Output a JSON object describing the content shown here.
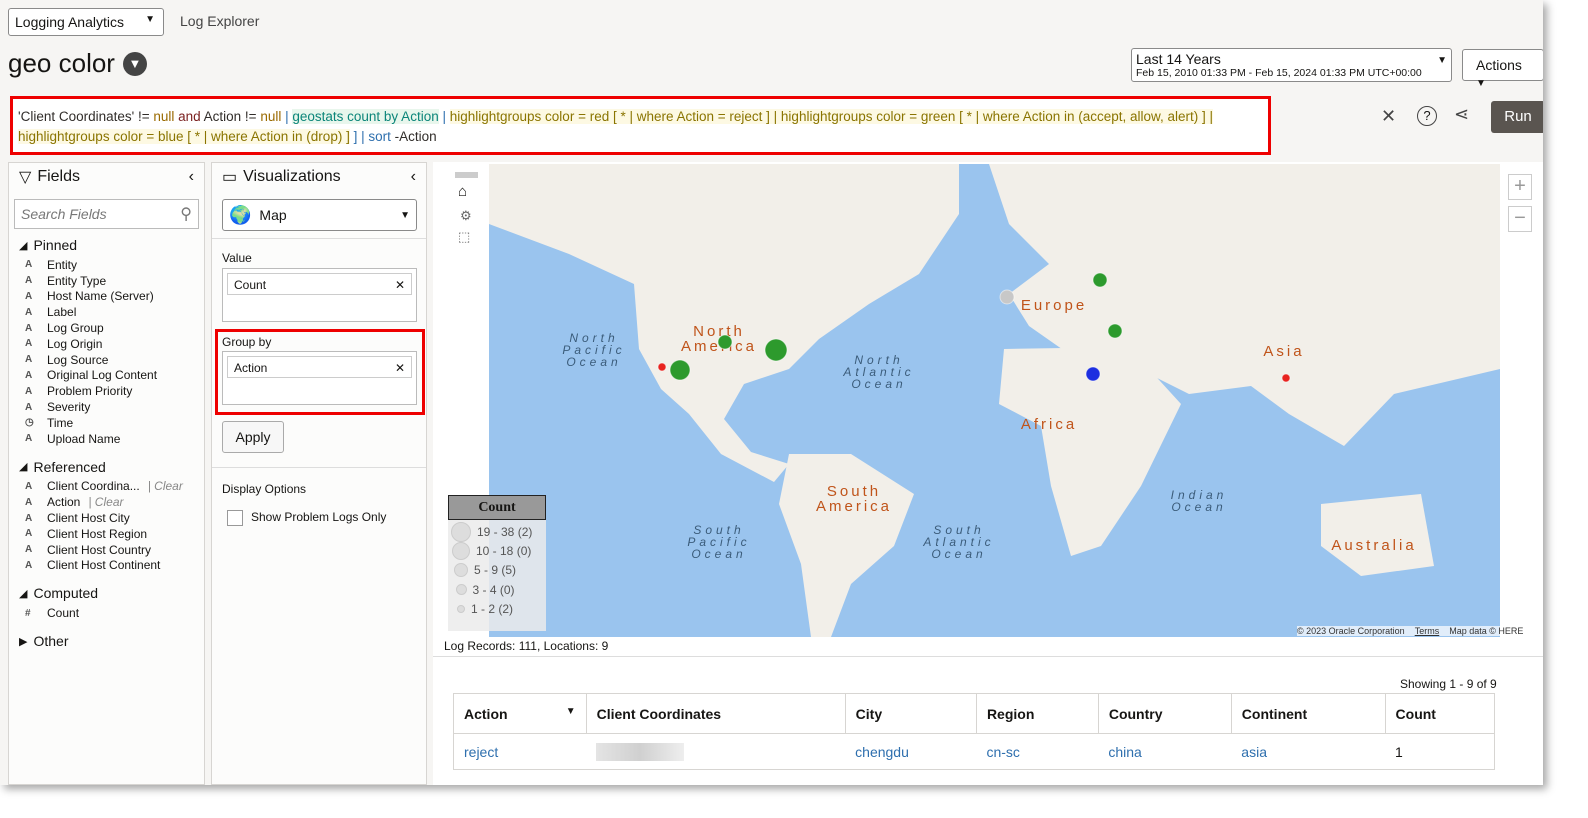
{
  "header": {
    "app_selector": "Logging Analytics",
    "breadcrumb": "Log Explorer",
    "title": "geo color",
    "time_range": "Last 14 Years",
    "time_detail": "Feb 15, 2010 01:33 PM - Feb 15, 2024 01:33 PM UTC+00:00",
    "actions": "Actions"
  },
  "query": {
    "parts": [
      "'Client Coordinates' != ",
      "null",
      " and ",
      "Action != ",
      "null",
      " | ",
      "geostats count by Action",
      " | ",
      "highlightgroups color = red [ * | where Action = reject ] | highlightgroups color = green [ * | where Action in (accept, allow, alert) ] |",
      "highlightgroups color = blue [ * | where Action in (drop) ]",
      " ] | ",
      "sort",
      " -Action"
    ],
    "run": "Run"
  },
  "fields": {
    "title": "Fields",
    "search_placeholder": "Search Fields",
    "pinned_label": "Pinned",
    "pinned": [
      {
        "t": "A",
        "n": "Entity"
      },
      {
        "t": "A",
        "n": "Entity Type"
      },
      {
        "t": "A",
        "n": "Host Name (Server)"
      },
      {
        "t": "A",
        "n": "Label"
      },
      {
        "t": "A",
        "n": "Log Group"
      },
      {
        "t": "A",
        "n": "Log Origin"
      },
      {
        "t": "A",
        "n": "Log Source"
      },
      {
        "t": "A",
        "n": "Original Log Content"
      },
      {
        "t": "A",
        "n": "Problem Priority"
      },
      {
        "t": "A",
        "n": "Severity"
      },
      {
        "t": "◷",
        "n": "Time"
      },
      {
        "t": "A",
        "n": "Upload Name"
      }
    ],
    "referenced_label": "Referenced",
    "referenced": [
      {
        "t": "A",
        "n": "Client Coordina...",
        "c": "| Clear"
      },
      {
        "t": "A",
        "n": "Action",
        "c": "| Clear"
      },
      {
        "t": "A",
        "n": "Client Host City"
      },
      {
        "t": "A",
        "n": "Client Host Region"
      },
      {
        "t": "A",
        "n": "Client Host Country"
      },
      {
        "t": "A",
        "n": "Client Host Continent"
      }
    ],
    "computed_label": "Computed",
    "computed": [
      {
        "t": "#",
        "n": "Count"
      }
    ],
    "other_label": "Other"
  },
  "viz": {
    "title": "Visualizations",
    "type": "Map",
    "value_label": "Value",
    "value": "Count",
    "groupby_label": "Group by",
    "groupby": "Action",
    "apply": "Apply",
    "display_options": "Display Options",
    "problem_logs": "Show Problem Logs Only"
  },
  "map": {
    "labels": {
      "na": "North America",
      "sa": "South America",
      "eu": "Europe",
      "af": "Africa",
      "as": "Asia",
      "au": "Australia",
      "npo": "North Pacific Ocean",
      "nao": "North Atlantic Ocean",
      "spo": "South Pacific Ocean",
      "sao": "South Atlantic Ocean",
      "io": "Indian Ocean"
    },
    "legend_title": "Count",
    "legend": [
      "19 - 38  (2)",
      "10 - 18  (0)",
      "5 - 9  (5)",
      "3 - 4  (0)",
      "1 - 2  (2)"
    ],
    "colors": {
      "red": "#e8231f",
      "green": "#2d9a2d",
      "blue": "#1d2fe0",
      "gray": "#c8c8c8",
      "ocean": "#9ac4ee",
      "land": "#f2efe9"
    },
    "copyright": "© 2023 Oracle Corporation",
    "terms": "Terms",
    "mapdata": "Map data © HERE"
  },
  "summary": "Log Records: 111, Locations: 9",
  "table": {
    "showing": "Showing 1 - 9 of 9",
    "columns": [
      "Action",
      "Client Coordinates",
      "City",
      "Region",
      "Country",
      "Continent",
      "Count"
    ],
    "rows": [
      {
        "action": "reject",
        "city": "chengdu",
        "region": "cn-sc",
        "country": "china",
        "continent": "asia",
        "count": "1"
      }
    ]
  }
}
